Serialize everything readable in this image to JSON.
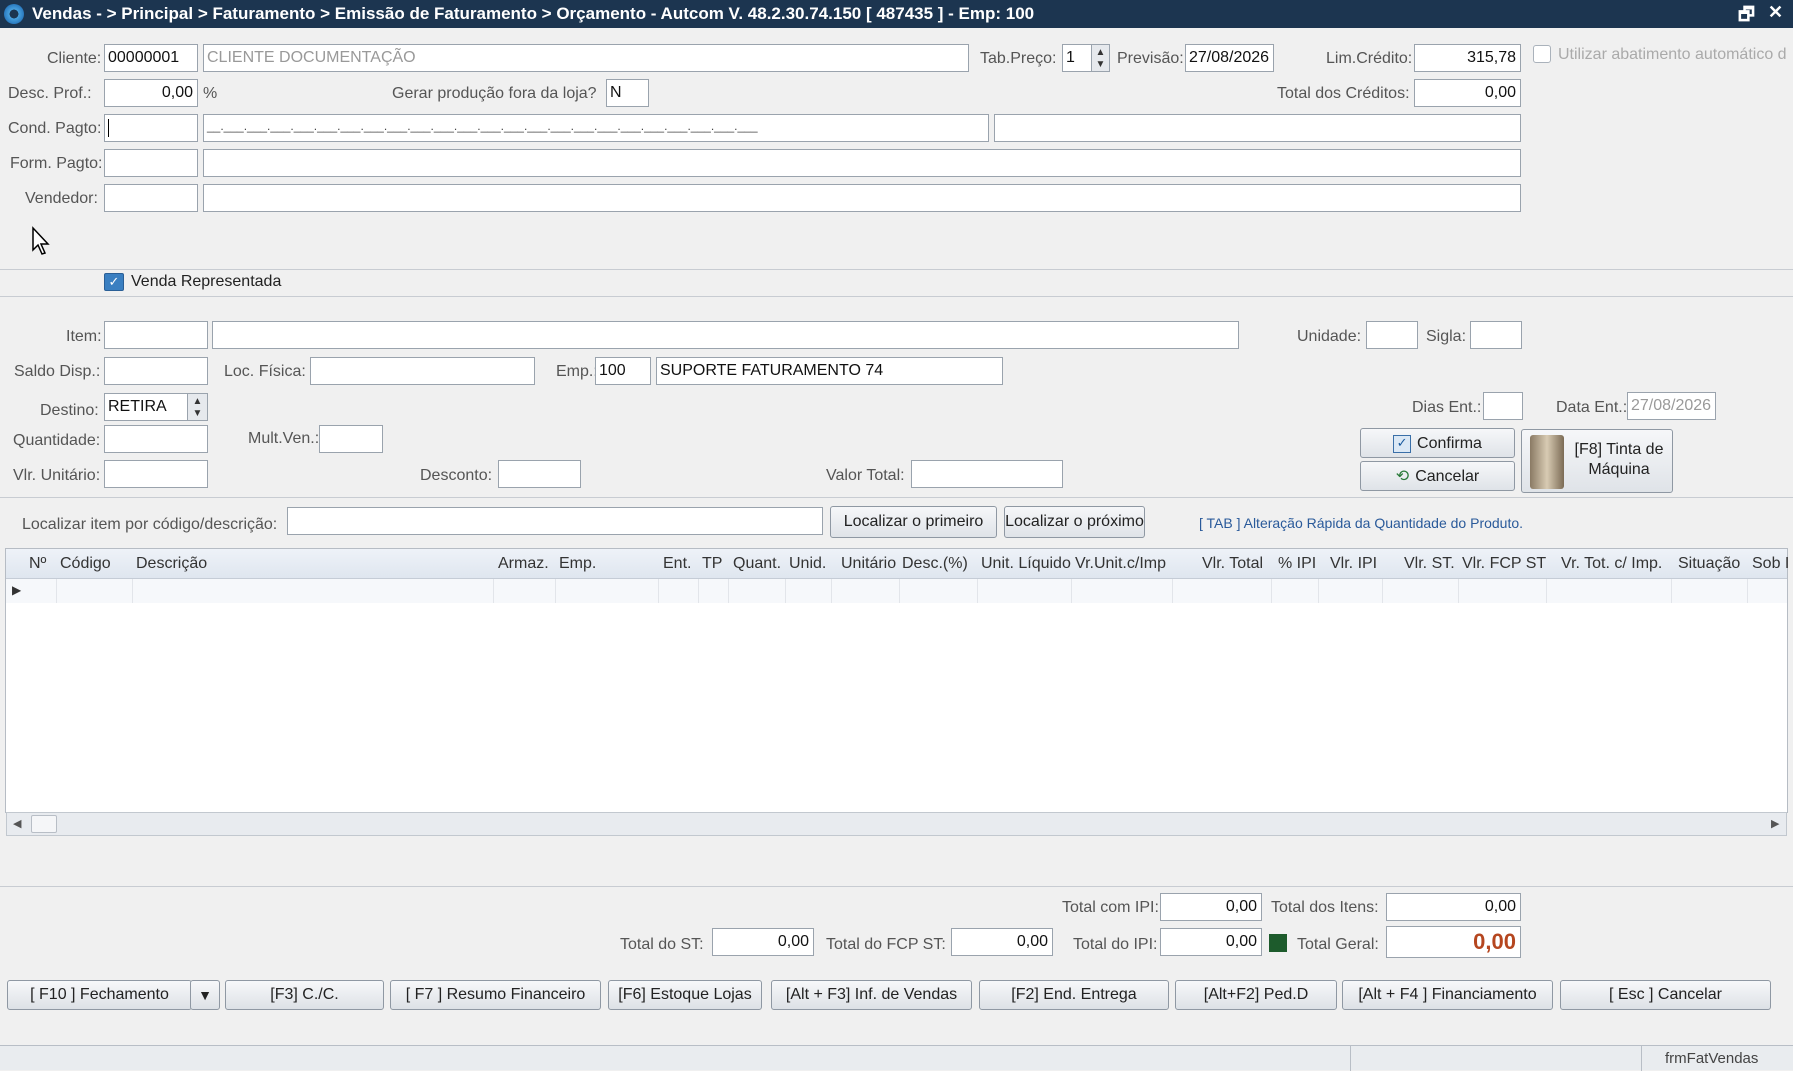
{
  "title_bar": {
    "title": "Vendas -  > Principal > Faturamento > Emissão de Faturamento > Orçamento   -   Autcom V. 48.2.30.74.150 [ 487435 ] - Emp: 100",
    "restore_icon": "restore-icon",
    "close_icon": "close-icon"
  },
  "header": {
    "cliente_label": "Cliente:",
    "cliente_code": "00000001",
    "cliente_name": "CLIENTE DOCUMENTAÇÃO",
    "tab_preco_label": "Tab.Preço:",
    "tab_preco_value": "1",
    "previsao_label": "Previsão:",
    "previsao_value": "27/08/2026",
    "lim_credito_label": "Lim.Crédito:",
    "lim_credito_value": "315,78",
    "abatimento_label": "Utilizar abatimento automático d",
    "desc_prof_label": "Desc. Prof.:",
    "desc_prof_value": "0,00",
    "desc_prof_unit": "%",
    "gerar_producao_label": "Gerar produção fora da loja?",
    "gerar_producao_value": "N",
    "total_creditos_label": "Total dos Créditos:",
    "total_creditos_value": "0,00",
    "cond_pagto_label": "Cond. Pagto:",
    "cond_pagto_mask": "__.___.___.___.___.___.___.___.___.___.___.___.___.___.___.___.___.___.___.___.___.___.___.___",
    "form_pagto_label": "Form. Pagto:",
    "vendedor_label": "Vendedor:"
  },
  "venda_representada": {
    "label": "Venda Representada",
    "checked": true
  },
  "item_section": {
    "item_label": "Item:",
    "unidade_label": "Unidade:",
    "sigla_label": "Sigla:",
    "saldo_label": "Saldo Disp.:",
    "loc_fisica_label": "Loc. Física:",
    "emp_label": "Emp.:",
    "emp_code": "100",
    "emp_name": "SUPORTE FATURAMENTO 74",
    "destino_label": "Destino:",
    "destino_value": "RETIRA",
    "dias_ent_label": "Dias Ent.:",
    "data_ent_label": "Data Ent.:",
    "data_ent_value": "27/08/2026",
    "quantidade_label": "Quantidade:",
    "mult_ven_label": "Mult.Ven.:",
    "vlr_unitario_label": "Vlr. Unitário:",
    "desconto_label": "Desconto:",
    "valor_total_label": "Valor Total:",
    "confirma_label": "Confirma",
    "cancelar_label": "Cancelar",
    "tinta_label_1": "[F8] Tinta de",
    "tinta_label_2": "Máquina"
  },
  "search": {
    "label": "Localizar item por código/descrição:",
    "first_button": "Localizar o primeiro",
    "next_button": "Localizar o próximo",
    "hint": "[ TAB ] Alteração Rápida da Quantidade do Produto."
  },
  "grid": {
    "columns": [
      "Nº",
      "Código",
      "Descrição",
      "Armaz.",
      "Emp.",
      "Ent.",
      "TP",
      "Quant.",
      "Unid.",
      "Unitário",
      "Desc.(%)",
      "Unit. Líquido",
      "Vr.Unit.c/Imp",
      "Vlr. Total",
      "% IPI",
      "Vlr. IPI",
      "Vlr. ST.",
      "Vlr. FCP ST",
      "Vr. Tot. c/ Imp.",
      "Situação",
      "Sob I"
    ]
  },
  "totals": {
    "total_com_ipi_label": "Total com IPI:",
    "total_com_ipi_value": "0,00",
    "total_itens_label": "Total dos Itens:",
    "total_itens_value": "0,00",
    "total_st_label": "Total do ST:",
    "total_st_value": "0,00",
    "total_fcp_label": "Total do FCP ST:",
    "total_fcp_value": "0,00",
    "total_ipi_label": "Total do IPI:",
    "total_ipi_value": "0,00",
    "total_geral_label": "Total Geral:",
    "total_geral_value": "0,00"
  },
  "footer_buttons": {
    "fechamento": "[ F10 ] Fechamento",
    "cc": "[F3] C./C.",
    "resumo": "[ F7 ] Resumo Financeiro",
    "estoque": "[F6] Estoque Lojas",
    "inf_vendas": "[Alt + F3] Inf. de Vendas",
    "end_entrega": "[F2] End. Entrega",
    "ped_d": "[Alt+F2] Ped.D",
    "financiamento": "[Alt + F4 ] Financiamento",
    "cancelar": "[ Esc ] Cancelar"
  },
  "status_bar": {
    "form_name": "frmFatVendas"
  },
  "colors": {
    "title_bg": "#1c3550",
    "total_geral": "#b5461f"
  }
}
